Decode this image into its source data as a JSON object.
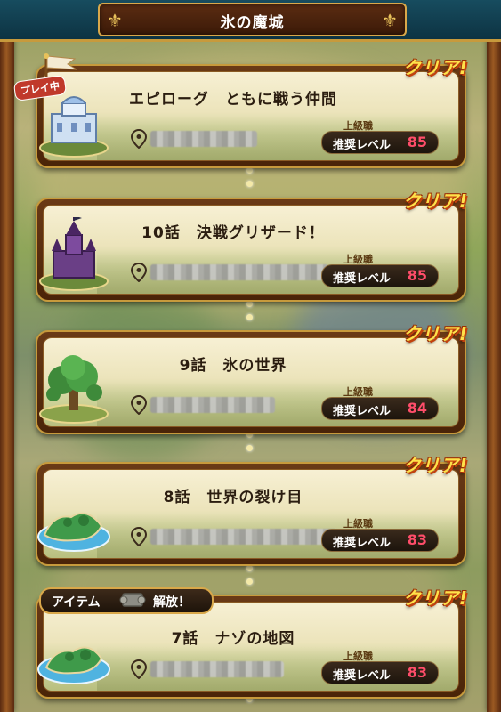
{
  "header": {
    "title": "氷の魔城"
  },
  "badges": {
    "playing": "プレイ中",
    "clear": "クリア!"
  },
  "stages": [
    {
      "title": "エピローグ　ともに戦う仲間",
      "rank": "上級職",
      "level_label": "推奨レベル",
      "level": "85",
      "thumb": "castle-building-icon",
      "playing": true
    },
    {
      "title": "10話　決戦グリザード！",
      "rank": "上級職",
      "level_label": "推奨レベル",
      "level": "85",
      "thumb": "dark-castle-icon"
    },
    {
      "title": "9話　氷の世界",
      "rank": "上級職",
      "level_label": "推奨レベル",
      "level": "84",
      "thumb": "forest-tree-icon"
    },
    {
      "title": "8話　世界の裂け目",
      "rank": "上級職",
      "level_label": "推奨レベル",
      "level": "83",
      "thumb": "island-icon"
    },
    {
      "title": "7話　ナゾの地図",
      "rank": "上級職",
      "level_label": "推奨レベル",
      "level": "83",
      "thumb": "island-icon"
    }
  ],
  "item_banner": {
    "left": "アイテム",
    "right": "解放！"
  },
  "colors": {
    "level_value": "#ff4d6a",
    "clear": "#ffe14a",
    "title_bar": "#174c5f"
  }
}
